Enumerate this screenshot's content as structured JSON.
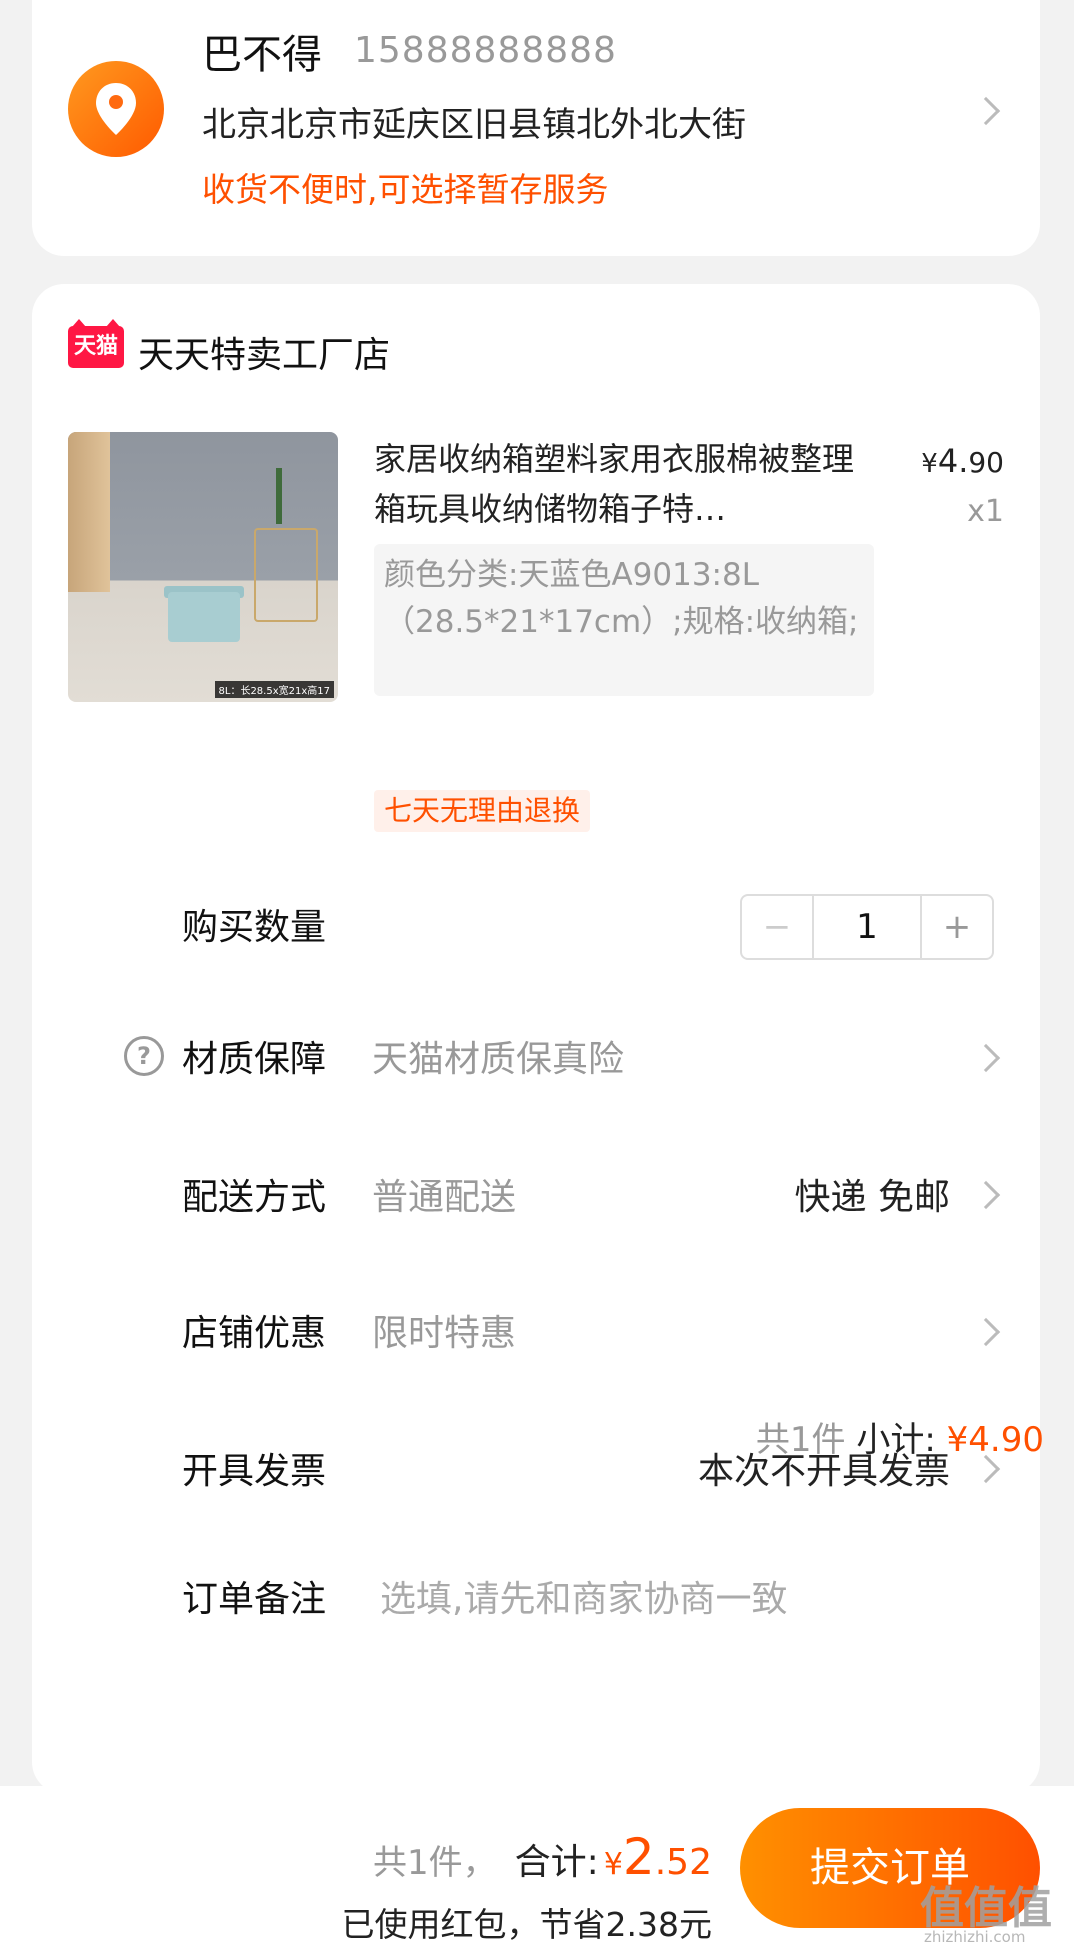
{
  "address": {
    "name": "巴不得",
    "phone": "15888888888",
    "detail": "北京北京市延庆区旧县镇北外北大街",
    "tip": "收货不便时,可选择暂存服务",
    "icon": "location-pin-icon"
  },
  "shop": {
    "badge": "天猫",
    "name": "天天特卖工厂店"
  },
  "product": {
    "title": "家居收纳箱塑料家用衣服棉被整理箱玩具收纳储物箱子特…",
    "price_yen": "¥",
    "price_int": "4.",
    "price_dec": "90",
    "quantity_label": "x1",
    "sku": "颜色分类:天蓝色A9013:8L（28.5*21*17cm）;规格:收纳箱;",
    "image_caption": "8L：长28.5x宽21x高17",
    "return_tag": "七天无理由退换"
  },
  "rows": {
    "quantity": {
      "label": "购买数量",
      "value": "1",
      "minus": "−",
      "plus": "+"
    },
    "material": {
      "label": "材质保障",
      "value": "天猫材质保真险",
      "help": "?"
    },
    "delivery": {
      "label": "配送方式",
      "value": "普通配送",
      "right": "快递 免邮"
    },
    "discount": {
      "label": "店铺优惠",
      "value": "限时特惠"
    },
    "invoice": {
      "label": "开具发票",
      "right": "本次不开具发票"
    },
    "note": {
      "label": "订单备注",
      "placeholder": "选填,请先和商家协商一致"
    }
  },
  "subtotal": {
    "count": "共1件",
    "label": "小计:",
    "amount": "¥4.90"
  },
  "footer": {
    "count": "共1件，",
    "label": "合计:",
    "yen": "¥",
    "int": "2",
    "dec": ".52",
    "saved": "已使用红包，节省2.38元",
    "submit": "提交订单"
  },
  "watermark": {
    "main": "值值值",
    "sub": "zhizhizhi.com"
  },
  "colors": {
    "accent": "#ff5000",
    "tmall": "#ff1744",
    "muted": "#999999"
  }
}
